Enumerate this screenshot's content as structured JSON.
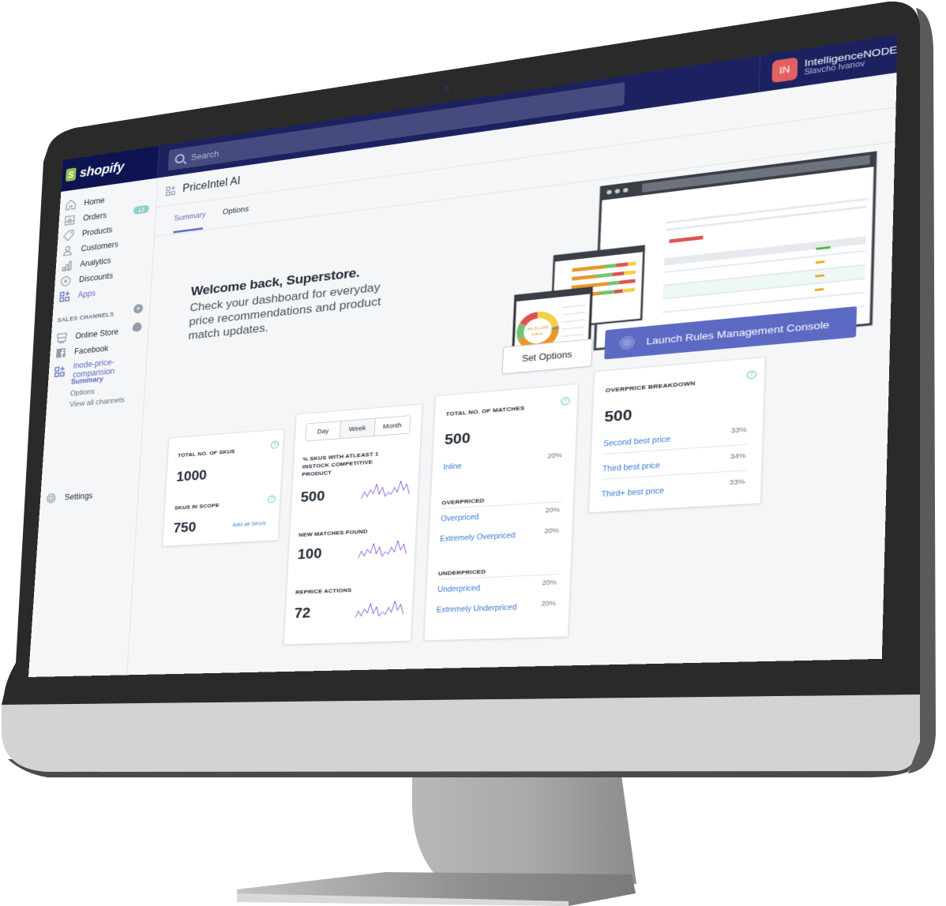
{
  "topbar": {
    "logo_text": "shopify",
    "search_placeholder": "Search",
    "avatar_initials": "IN",
    "store_name": "IntelligenceNODE",
    "user_name": "Slavcho Ivanov"
  },
  "sidebar": {
    "items": [
      {
        "label": "Home",
        "icon": "home-icon"
      },
      {
        "label": "Orders",
        "icon": "orders-icon",
        "badge": "12"
      },
      {
        "label": "Products",
        "icon": "tag-icon"
      },
      {
        "label": "Customers",
        "icon": "person-icon"
      },
      {
        "label": "Analytics",
        "icon": "bar-chart-icon"
      },
      {
        "label": "Discounts",
        "icon": "discount-icon"
      },
      {
        "label": "Apps",
        "icon": "apps-icon",
        "active": true
      }
    ],
    "sales_channels_label": "SALES CHANNELS",
    "channels": [
      {
        "label": "Online Store",
        "icon": "store-icon"
      },
      {
        "label": "Facebook",
        "icon": "facebook-icon"
      },
      {
        "label": "inode-price-comparision",
        "icon": "apps-icon",
        "active": true
      }
    ],
    "sub_items": [
      {
        "label": "Summary",
        "active": true
      },
      {
        "label": "Options"
      },
      {
        "label": "View all channels"
      }
    ],
    "settings_label": "Settings"
  },
  "page": {
    "title": "PriceIntel AI",
    "tabs": [
      {
        "label": "Summary",
        "active": true
      },
      {
        "label": "Options"
      }
    ]
  },
  "hero": {
    "heading": "Welcome back, Superstore.",
    "body": "Check your dashboard for everyday price recommendations and product match updates.",
    "set_options_label": "Set Options",
    "launch_label": "Launch Rules Management Console",
    "illustration_donut_label": "44,31,283",
    "illustration_donut_sub": "inline"
  },
  "cards": {
    "skus": {
      "total_label": "TOTAL NO. OF SKUS",
      "total_value": "1000",
      "scope_label": "SKUS IN SCOPE",
      "scope_value": "750",
      "add_link": "Add all SKUs"
    },
    "trends": {
      "periods": [
        "Day",
        "Week",
        "Month"
      ],
      "selected_period": "Week",
      "metrics": [
        {
          "label": "% SKUS WITH ATLEAST 1 INSTOCK COMPETITIVE PRODUCT",
          "value": "500"
        },
        {
          "label": "NEW MATCHES FOUND",
          "value": "100"
        },
        {
          "label": "REPRICE ACTIONS",
          "value": "72"
        }
      ],
      "sparkline": [
        4,
        12,
        6,
        14,
        9,
        20,
        8,
        16,
        5,
        10,
        7,
        15,
        9,
        22,
        11,
        18,
        6
      ]
    },
    "matches": {
      "label": "TOTAL NO. OF MATCHES",
      "value": "500",
      "inline": {
        "label": "Inline",
        "pct": "20%"
      },
      "overpriced_label": "OVERPRICED",
      "overpriced": [
        {
          "label": "Overpriced",
          "pct": "20%"
        },
        {
          "label": "Extremely Overpriced",
          "pct": "20%"
        }
      ],
      "underpriced_label": "UNDERPRICED",
      "underpriced": [
        {
          "label": "Underpriced",
          "pct": "20%"
        },
        {
          "label": "Extremely Underpriced",
          "pct": "20%"
        }
      ]
    },
    "overprice": {
      "label": "OVERPRICE BREAKDOWN",
      "value": "500",
      "rows": [
        {
          "label": "Second best price",
          "pct": "33%"
        },
        {
          "label": "Third best price",
          "pct": "34%"
        },
        {
          "label": "Third+ best price",
          "pct": "33%"
        }
      ]
    }
  },
  "colors": {
    "topbar": "#1c2260",
    "accent": "#5c6ac4",
    "link": "#3c78d8",
    "help": "#47c1bf",
    "avatar": "#e26160",
    "sparkline": "#8a5cd6"
  }
}
